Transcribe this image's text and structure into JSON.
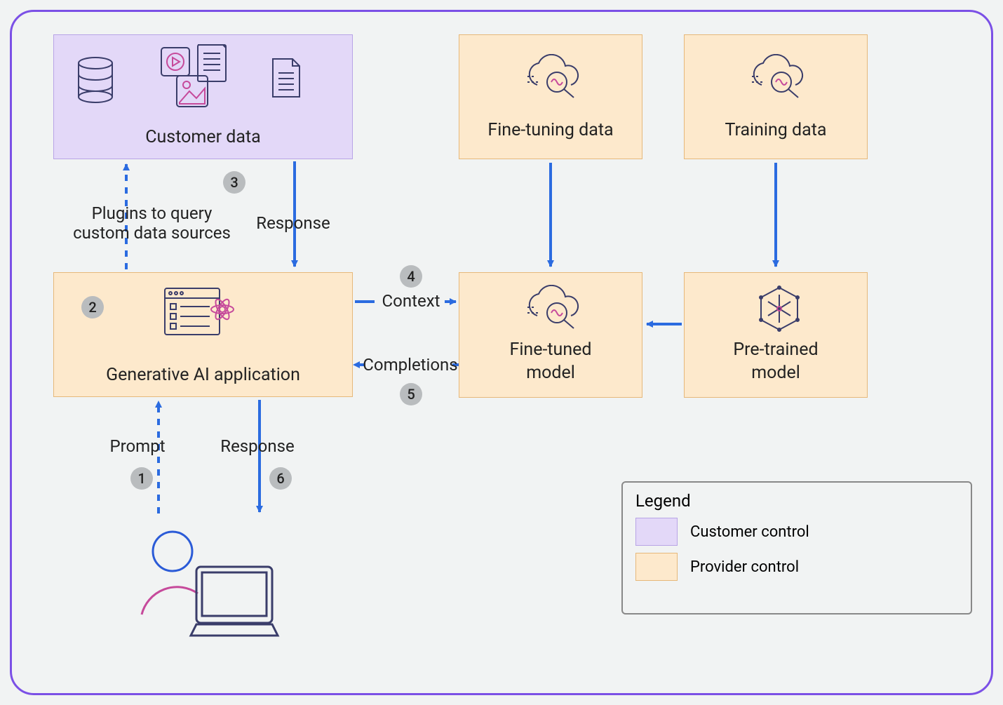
{
  "nodes": {
    "customer_data": "Customer data",
    "gen_ai_app": "Generative AI application",
    "fine_tuning_data": "Fine-tuning data",
    "fine_tuned_model": "Fine-tuned model",
    "training_data": "Training data",
    "pretrained_model": "Pre-trained model"
  },
  "annotations": {
    "plugins": "Plugins to query\ncustom data sources",
    "response_top": "Response",
    "context": "Context",
    "completions": "Completions",
    "prompt": "Prompt",
    "response_bottom": "Response"
  },
  "steps": {
    "1": "1",
    "2": "2",
    "3": "3",
    "4": "4",
    "5": "5",
    "6": "6"
  },
  "legend": {
    "title": "Legend",
    "customer": "Customer control",
    "provider": "Provider control"
  },
  "chart_data": {
    "type": "diagram",
    "title": "Generative AI application data flow",
    "nodes": [
      {
        "id": "customer_data",
        "label": "Customer data",
        "group": "customer"
      },
      {
        "id": "gen_ai_app",
        "label": "Generative AI application",
        "group": "provider"
      },
      {
        "id": "fine_tuning_data",
        "label": "Fine-tuning data",
        "group": "provider"
      },
      {
        "id": "fine_tuned_model",
        "label": "Fine-tuned model",
        "group": "provider"
      },
      {
        "id": "training_data",
        "label": "Training data",
        "group": "provider"
      },
      {
        "id": "pretrained_model",
        "label": "Pre-trained model",
        "group": "provider"
      },
      {
        "id": "user",
        "label": "User",
        "group": "actor"
      }
    ],
    "edges": [
      {
        "from": "user",
        "to": "gen_ai_app",
        "label": "Prompt",
        "step": 1
      },
      {
        "from": "gen_ai_app",
        "to": "customer_data",
        "label": "Plugins to query custom data sources",
        "step": 3
      },
      {
        "from": "customer_data",
        "to": "gen_ai_app",
        "label": "Response",
        "step": 3
      },
      {
        "from": "gen_ai_app",
        "to": "fine_tuned_model",
        "label": "Context",
        "step": 4
      },
      {
        "from": "fine_tuned_model",
        "to": "gen_ai_app",
        "label": "Completions",
        "step": 5
      },
      {
        "from": "gen_ai_app",
        "to": "user",
        "label": "Response",
        "step": 6
      },
      {
        "from": "fine_tuning_data",
        "to": "fine_tuned_model",
        "label": null,
        "step": null
      },
      {
        "from": "training_data",
        "to": "pretrained_model",
        "label": null,
        "step": null
      },
      {
        "from": "pretrained_model",
        "to": "fine_tuned_model",
        "label": null,
        "step": null
      }
    ],
    "step_anchor": {
      "2": "gen_ai_app"
    },
    "legend": [
      {
        "group": "customer",
        "label": "Customer control"
      },
      {
        "group": "provider",
        "label": "Provider control"
      }
    ]
  }
}
